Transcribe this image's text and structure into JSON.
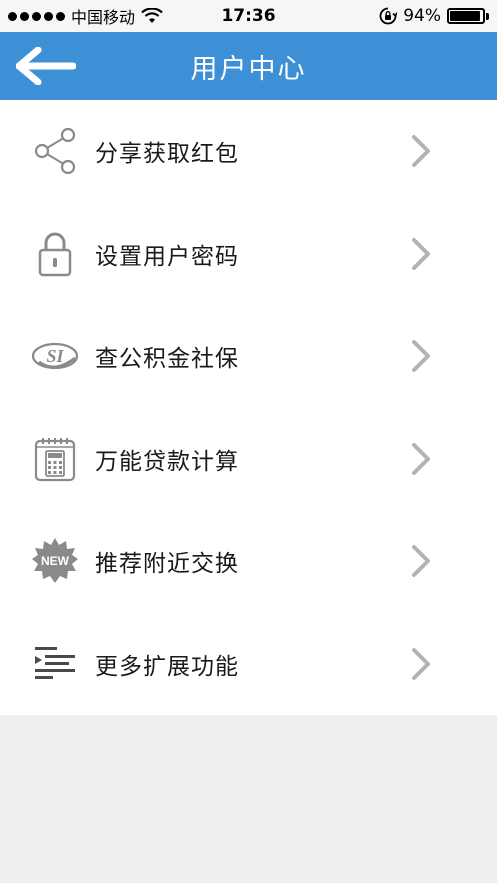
{
  "status_bar": {
    "carrier": "中国移动",
    "time": "17:36",
    "battery_percent": "94%",
    "battery_level": 0.94
  },
  "nav": {
    "title": "用户中心",
    "back_icon": "arrow-left-icon"
  },
  "menu": {
    "items": [
      {
        "label": "分享获取红包",
        "icon": "share-icon"
      },
      {
        "label": "设置用户密码",
        "icon": "lock-icon"
      },
      {
        "label": "查公积金社保",
        "icon": "si-logo-icon"
      },
      {
        "label": "万能贷款计算",
        "icon": "calculator-icon"
      },
      {
        "label": "推荐附近交换",
        "icon": "new-badge-icon"
      },
      {
        "label": "更多扩展功能",
        "icon": "more-list-icon"
      }
    ],
    "chevron_icon": "chevron-right-icon"
  },
  "colors": {
    "nav_bg": "#3d8fd6",
    "page_bg": "#efefef",
    "list_bg": "#ffffff",
    "icon_gray": "#8a8a8a",
    "chevron_gray": "#b3b3b3"
  }
}
